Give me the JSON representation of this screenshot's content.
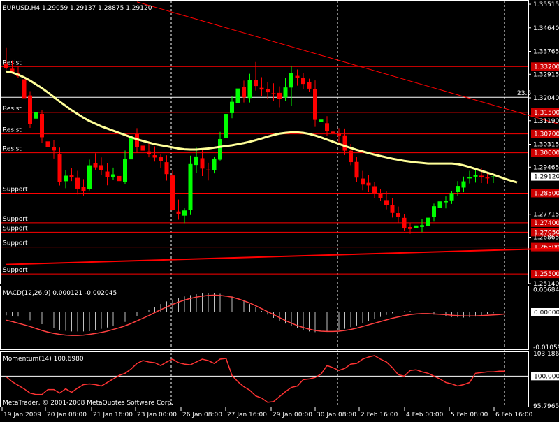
{
  "window": {
    "header_text": "EURUSD,H4  1.29059 1.29137 1.28875 1.29120",
    "copyright": "MetaTrader, © 2001-2008 MetaQuotes Software Corp."
  },
  "colors": {
    "background": "#000000",
    "grid": "#ffffff",
    "bull_candle": "#00ff00",
    "bear_candle": "#ff0000",
    "moving_average": "#ffff99",
    "level_line": "#ff0000",
    "trend_line": "#ff0000",
    "level_tag_bg": "#cc0000",
    "macd_histogram": "#c0c0c0",
    "macd_signal": "#ff4040",
    "momentum_line": "#ff3333"
  },
  "chart_data": [
    {
      "type": "candlestick",
      "title": "EURUSD,H4  1.29059 1.29137 1.28875 1.29120",
      "symbol": "EURUSD",
      "timeframe": "H4",
      "ohlc_header": {
        "open": 1.29059,
        "high": 1.29137,
        "low": 1.28875,
        "close": 1.2912
      },
      "current_price_label": "1.29120",
      "ylim": [
        1.2514,
        1.3562
      ],
      "y_tick_labels": [
        "1.35515",
        "1.34640",
        "1.33765",
        "1.32915",
        "1.32040",
        "1.31190",
        "1.30315",
        "1.29465",
        "1.27715",
        "1.26865",
        "1.25140"
      ],
      "y_tick_values": [
        1.35515,
        1.3464,
        1.33765,
        1.32915,
        1.3204,
        1.3119,
        1.30315,
        1.29465,
        1.27715,
        1.26865,
        1.2514
      ],
      "x_tick_labels": [
        "19 Jan 2009",
        "20 Jan 08:00",
        "21 Jan 16:00",
        "23 Jan 00:00",
        "26 Jan 08:00",
        "27 Jan 16:00",
        "29 Jan 00:00",
        "30 Jan 08:00",
        "2 Feb 16:00",
        "4 Feb 00:00",
        "5 Feb 08:00",
        "6 Feb 16:00"
      ],
      "levels": [
        {
          "price": 1.332,
          "tag": "1.33200",
          "label": "Resist"
        },
        {
          "price": 1.315,
          "tag": "1.31500",
          "label": "Resist"
        },
        {
          "price": 1.307,
          "tag": "1.30700",
          "label": "Resist"
        },
        {
          "price": 1.3,
          "tag": "1.30000",
          "label": "Resist"
        },
        {
          "price": 1.285,
          "tag": "1.28500",
          "label": "Support"
        },
        {
          "price": 1.274,
          "tag": "1.27400",
          "label": "Support"
        },
        {
          "price": 1.2705,
          "tag": "1.27050",
          "label": "Support"
        },
        {
          "price": 1.265,
          "tag": "1.26500",
          "label": "Support"
        },
        {
          "price": 1.255,
          "tag": "1.25500",
          "label": "Support"
        }
      ],
      "extra_line": {
        "price": 1.3206,
        "label": "23.6"
      },
      "trendlines": [
        {
          "from": [
            22,
            1.356
          ],
          "to": [
            123,
            1.2915
          ]
        },
        {
          "from": [
            0,
            1.2585
          ],
          "to": [
            123,
            1.2665
          ]
        }
      ],
      "moving_average": [
        1.3302,
        1.3298,
        1.329,
        1.328,
        1.3268,
        1.3254,
        1.324,
        1.3224,
        1.3207,
        1.319,
        1.3174,
        1.3158,
        1.3144,
        1.313,
        1.3118,
        1.3108,
        1.3098,
        1.309,
        1.3082,
        1.3074,
        1.3066,
        1.3058,
        1.305,
        1.3044,
        1.3038,
        1.3032,
        1.3028,
        1.3024,
        1.302,
        1.3016,
        1.3013,
        1.3012,
        1.3012,
        1.3014,
        1.3016,
        1.3019,
        1.3022,
        1.3025,
        1.3028,
        1.3032,
        1.3036,
        1.3041,
        1.3047,
        1.3053,
        1.306,
        1.3066,
        1.3071,
        1.3074,
        1.3076,
        1.3076,
        1.3074,
        1.307,
        1.3064,
        1.3057,
        1.3049,
        1.3041,
        1.3033,
        1.3025,
        1.3018,
        1.3011,
        1.3005,
        1.2999,
        1.2993,
        1.2988,
        1.2983,
        1.2978,
        1.2974,
        1.297,
        1.2967,
        1.2964,
        1.2962,
        1.296,
        1.296,
        1.296,
        1.296,
        1.296,
        1.2958,
        1.2953,
        1.2947,
        1.294,
        1.2933,
        1.2926,
        1.2919,
        1.2911,
        1.2903,
        1.2896,
        1.289
      ],
      "momentum": {
        "name": "Momentum(14)",
        "value": "100.6980",
        "ylim": [
          95.79,
          103.19
        ],
        "y_tick_labels": [
          "103.1869",
          "100.0000",
          "95.7965"
        ],
        "values": [
          99.9,
          99.2,
          98.7,
          98.2,
          97.6,
          97.4,
          97.4,
          98.1,
          98.1,
          97.6,
          98.2,
          97.7,
          98.3,
          98.8,
          98.9,
          98.8,
          98.6,
          99.1,
          99.6,
          100.1,
          100.4,
          101.0,
          101.8,
          102.2,
          102.0,
          101.9,
          101.5,
          102.0,
          102.4,
          101.9,
          101.7,
          101.6,
          102.0,
          102.4,
          102.2,
          101.8,
          102.4,
          102.5,
          100.1,
          99.2,
          98.5,
          98.0,
          97.2,
          96.9,
          96.3,
          96.4,
          97.1,
          97.8,
          98.4,
          98.6,
          99.5,
          99.6,
          99.8,
          100.3,
          101.5,
          101.2,
          100.8,
          101.1,
          101.7,
          101.8,
          102.4,
          102.7,
          102.9,
          102.4,
          102.0,
          101.2,
          100.2,
          100.0,
          100.8,
          100.9,
          100.6,
          100.4,
          100.0,
          99.6,
          99.1,
          98.9,
          98.6,
          98.8,
          99.1,
          100.4,
          100.5,
          100.6,
          100.6,
          100.7,
          100.7
        ]
      },
      "macd": {
        "name": "MACD(12,26,9)",
        "value1": "0.000121",
        "value2": "-0.002045",
        "ylim": [
          -0.011,
          0.0074
        ],
        "y_tick_labels": [
          "0.006842",
          "0.000000",
          "-0.010595"
        ],
        "histogram": [
          -0.0009,
          -0.0011,
          -0.0013,
          -0.0015,
          -0.0024,
          -0.003,
          -0.0036,
          -0.0042,
          -0.0048,
          -0.0053,
          -0.0056,
          -0.0058,
          -0.0058,
          -0.0058,
          -0.0057,
          -0.0054,
          -0.005,
          -0.0046,
          -0.0041,
          -0.0036,
          -0.0029,
          -0.0021,
          -0.0011,
          -0.0002,
          0.0007,
          0.0016,
          0.0025,
          0.0033,
          0.0039,
          0.0044,
          0.0048,
          0.0052,
          0.0055,
          0.0057,
          0.0058,
          0.0058,
          0.0056,
          0.0053,
          0.0048,
          0.0042,
          0.0034,
          0.0025,
          0.0015,
          0.0004,
          -0.0007,
          -0.0017,
          -0.0026,
          -0.0034,
          -0.0041,
          -0.0048,
          -0.0054,
          -0.0058,
          -0.006,
          -0.006,
          -0.0059,
          -0.0057,
          -0.0054,
          -0.005,
          -0.0045,
          -0.004,
          -0.0033,
          -0.0027,
          -0.002,
          -0.0014,
          -0.0008,
          -0.0003,
          0.0001,
          0.0003,
          0.0004,
          0.0003,
          0.0,
          -0.0003,
          -0.0007,
          -0.001,
          -0.0012,
          -0.0014,
          -0.0015,
          -0.0016,
          -0.0015,
          -0.0013,
          -0.001,
          -0.0006,
          -0.0003,
          0.0,
          0.0001
        ],
        "signal": [
          -0.0024,
          -0.0028,
          -0.0033,
          -0.0038,
          -0.0043,
          -0.0049,
          -0.0055,
          -0.006,
          -0.0064,
          -0.0067,
          -0.0069,
          -0.007,
          -0.007,
          -0.0069,
          -0.0067,
          -0.0064,
          -0.0061,
          -0.0057,
          -0.0052,
          -0.0047,
          -0.0041,
          -0.0034,
          -0.0026,
          -0.0018,
          -0.001,
          -0.0001,
          0.0008,
          0.0016,
          0.0024,
          0.0031,
          0.0037,
          0.0042,
          0.0046,
          0.0049,
          0.0051,
          0.0052,
          0.0051,
          0.0049,
          0.0046,
          0.0041,
          0.0035,
          0.0028,
          0.002,
          0.0011,
          0.0002,
          -0.0007,
          -0.0016,
          -0.0025,
          -0.0033,
          -0.004,
          -0.0046,
          -0.0051,
          -0.0055,
          -0.0057,
          -0.0058,
          -0.0058,
          -0.0057,
          -0.0055,
          -0.0052,
          -0.0048,
          -0.0043,
          -0.0038,
          -0.0033,
          -0.0028,
          -0.0023,
          -0.0018,
          -0.0014,
          -0.001,
          -0.0007,
          -0.0005,
          -0.0004,
          -0.0004,
          -0.0005,
          -0.0006,
          -0.0007,
          -0.0009,
          -0.001,
          -0.0011,
          -0.0011,
          -0.0011,
          -0.001,
          -0.0009,
          -0.0008,
          -0.0007,
          -0.0005
        ]
      },
      "candles": [
        [
          1.33319,
          1.33915,
          1.3309,
          1.33144
        ],
        [
          1.33119,
          1.33425,
          1.32935,
          1.32998
        ],
        [
          1.32974,
          1.33218,
          1.32767,
          1.32843
        ],
        [
          1.32727,
          1.32978,
          1.31938,
          1.3203
        ],
        [
          1.32128,
          1.32287,
          1.30924,
          1.31065
        ],
        [
          1.31268,
          1.31677,
          1.30982,
          1.31503
        ],
        [
          1.31444,
          1.31583,
          1.30373,
          1.30576
        ],
        [
          1.30424,
          1.30666,
          1.30096,
          1.30201
        ],
        [
          1.30212,
          1.30472,
          1.29785,
          1.30085
        ],
        [
          1.29947,
          1.30193,
          1.28786,
          1.28926
        ],
        [
          1.28943,
          1.29345,
          1.28684,
          1.29148
        ],
        [
          1.29159,
          1.2944,
          1.2895,
          1.29085
        ],
        [
          1.29068,
          1.29331,
          1.28453,
          1.28669
        ],
        [
          1.2872,
          1.2902,
          1.28412,
          1.28581
        ],
        [
          1.28661,
          1.29748,
          1.28599,
          1.29535
        ],
        [
          1.29604,
          1.29982,
          1.2937,
          1.29457
        ],
        [
          1.29538,
          1.29829,
          1.29177,
          1.29343
        ],
        [
          1.29303,
          1.29611,
          1.28791,
          1.29101
        ],
        [
          1.2911,
          1.29449,
          1.28979,
          1.29198
        ],
        [
          1.29137,
          1.29384,
          1.28789,
          1.28948
        ],
        [
          1.28918,
          1.30086,
          1.28835,
          1.29778
        ],
        [
          1.29754,
          1.30908,
          1.29674,
          1.30606
        ],
        [
          1.30691,
          1.30915,
          1.29998,
          1.30211
        ],
        [
          1.30265,
          1.30463,
          1.29599,
          1.3008
        ],
        [
          1.30051,
          1.3038,
          1.29833,
          1.29938
        ],
        [
          1.29911,
          1.30238,
          1.29674,
          1.29823
        ],
        [
          1.29834,
          1.29944,
          1.29424,
          1.29691
        ],
        [
          1.2965,
          1.29907,
          1.28966,
          1.29207
        ],
        [
          1.29157,
          1.29334,
          1.27857,
          1.2787
        ],
        [
          1.27819,
          1.28263,
          1.27515,
          1.27715
        ],
        [
          1.27665,
          1.27938,
          1.27391,
          1.27857
        ],
        [
          1.27885,
          1.29893,
          1.27688,
          1.29581
        ],
        [
          1.29546,
          1.30196,
          1.29247,
          1.29864
        ],
        [
          1.29798,
          1.30134,
          1.29136,
          1.29412
        ],
        [
          1.29375,
          1.2963,
          1.28974,
          1.29349
        ],
        [
          1.2935,
          1.29858,
          1.29234,
          1.29785
        ],
        [
          1.29744,
          1.30776,
          1.29712,
          1.30509
        ],
        [
          1.30553,
          1.31608,
          1.30288,
          1.31442
        ],
        [
          1.31472,
          1.32097,
          1.3128,
          1.31894
        ],
        [
          1.31854,
          1.32581,
          1.31602,
          1.32387
        ],
        [
          1.32429,
          1.32679,
          1.31869,
          1.32057
        ],
        [
          1.32034,
          1.32933,
          1.31868,
          1.32691
        ],
        [
          1.32689,
          1.33371,
          1.32309,
          1.32478
        ],
        [
          1.32412,
          1.32807,
          1.32113,
          1.32347
        ],
        [
          1.32376,
          1.32612,
          1.31985,
          1.32245
        ],
        [
          1.32212,
          1.32579,
          1.31918,
          1.32193
        ],
        [
          1.32225,
          1.32464,
          1.3169,
          1.3199
        ],
        [
          1.32054,
          1.32791,
          1.31924,
          1.32425
        ],
        [
          1.32421,
          1.33214,
          1.31743,
          1.32948
        ],
        [
          1.32855,
          1.33092,
          1.32491,
          1.32783
        ],
        [
          1.32793,
          1.32964,
          1.32354,
          1.32555
        ],
        [
          1.32613,
          1.32749,
          1.32247,
          1.3238
        ],
        [
          1.32373,
          1.32686,
          1.3096,
          1.31221
        ],
        [
          1.31157,
          1.31514,
          1.30792,
          1.3123
        ],
        [
          1.31098,
          1.31359,
          1.30618,
          1.30811
        ],
        [
          1.30787,
          1.31031,
          1.30445,
          1.30727
        ],
        [
          1.30716,
          1.30915,
          1.30283,
          1.30643
        ],
        [
          1.30646,
          1.30903,
          1.29917,
          1.30079
        ],
        [
          1.30076,
          1.30327,
          1.29541,
          1.29652
        ],
        [
          1.2966,
          1.29838,
          1.28915,
          1.29077
        ],
        [
          1.29042,
          1.29326,
          1.28608,
          1.28817
        ],
        [
          1.28885,
          1.29169,
          1.28538,
          1.28786
        ],
        [
          1.28759,
          1.28901,
          1.28308,
          1.28475
        ],
        [
          1.28473,
          1.28644,
          1.28208,
          1.28305
        ],
        [
          1.28243,
          1.28573,
          1.27898,
          1.28059
        ],
        [
          1.28066,
          1.28304,
          1.27596,
          1.27766
        ],
        [
          1.27759,
          1.28002,
          1.27407,
          1.27605
        ],
        [
          1.27583,
          1.27722,
          1.27086,
          1.27188
        ],
        [
          1.27241,
          1.27402,
          1.26993,
          1.27168
        ],
        [
          1.27213,
          1.27511,
          1.26937,
          1.27299
        ],
        [
          1.27246,
          1.27551,
          1.27052,
          1.27311
        ],
        [
          1.27282,
          1.2771,
          1.27128,
          1.27589
        ],
        [
          1.27624,
          1.28113,
          1.27438,
          1.28015
        ],
        [
          1.27955,
          1.28282,
          1.27795,
          1.28195
        ],
        [
          1.28162,
          1.28378,
          1.27936,
          1.28213
        ],
        [
          1.28232,
          1.28587,
          1.28102,
          1.28501
        ],
        [
          1.28539,
          1.28947,
          1.28383,
          1.28769
        ],
        [
          1.28707,
          1.29117,
          1.28536,
          1.28939
        ],
        [
          1.29047,
          1.29327,
          1.2886,
          1.29081
        ],
        [
          1.29112,
          1.29438,
          1.28892,
          1.29176
        ],
        [
          1.29149,
          1.29416,
          1.28875,
          1.29097
        ],
        [
          1.2908,
          1.29269,
          1.28855,
          1.29048
        ],
        [
          1.29085,
          1.29137,
          1.28875,
          1.2912
        ]
      ]
    }
  ]
}
